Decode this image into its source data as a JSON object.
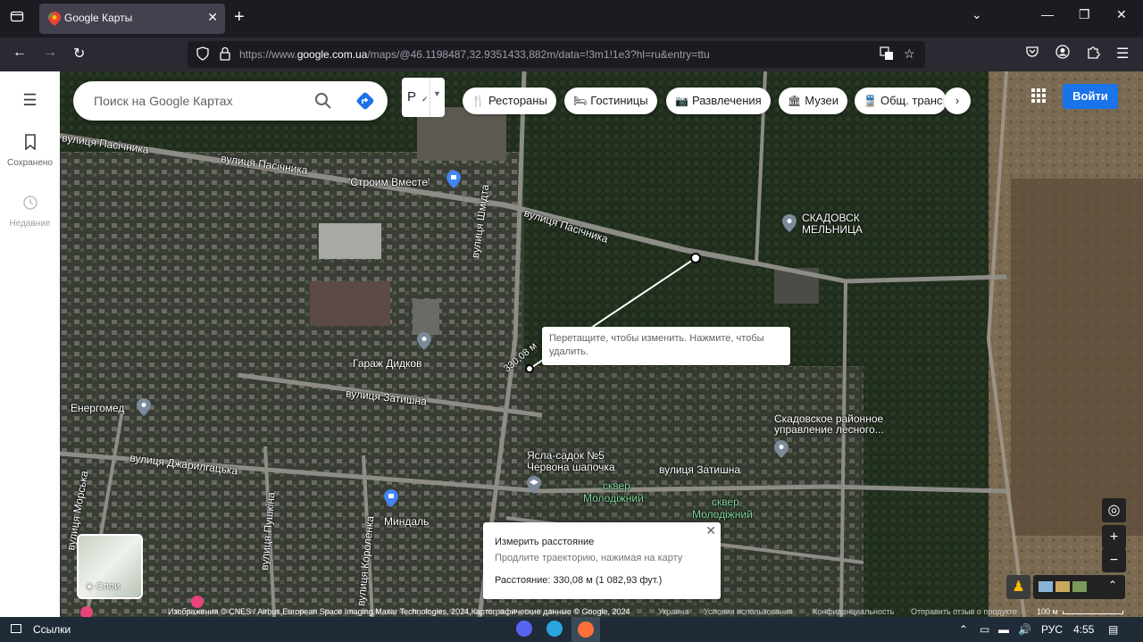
{
  "browser": {
    "tab_title": "Google Карты",
    "url_prefix": "https://www.",
    "url_domain": "google.com.ua",
    "url_rest": "/maps/@46.1198487,32.9351433,882m/data=!3m1!1e3?hl=ru&entry=ttu"
  },
  "sidebar": {
    "menu_icon": "menu-icon",
    "saved_label": "Сохранено",
    "recent_label": "Недавние"
  },
  "search": {
    "placeholder": "Поиск на Google Картах"
  },
  "language_button": "Р",
  "chips": [
    {
      "label": "Рестораны",
      "icon": "restaurant-icon"
    },
    {
      "label": "Гостиницы",
      "icon": "hotel-icon"
    },
    {
      "label": "Развлечения",
      "icon": "camera-icon"
    },
    {
      "label": "Музеи",
      "icon": "museum-icon"
    },
    {
      "label": "Общ. транс",
      "icon": "transit-icon"
    }
  ],
  "login_label": "Войти",
  "map_labels": {
    "street_1": "вулиця Пасічника",
    "street_2": "вулиця Пасічника",
    "street_3": "вулиця Пасічника",
    "stroim": "'Строим Вместе'",
    "skadovsk_mill_1": "СКАДОВСК",
    "skadovsk_mill_2": "МЕЛЬНИЦА",
    "schmidt": "вулиця Шмідта",
    "garage": "Гараж Дидков",
    "zatyshna_1": "вулиця Затишна",
    "zatyshna_2": "вулиця Затишна",
    "energomed": "Енергомед",
    "forestry_1": "Скадовское районное",
    "forestry_2": "управление лесного...",
    "dzharylgatska": "вулиця Джарилгацька",
    "kindergarten_1": "Ясла-садок №5",
    "kindergarten_2": "Червона шапочка",
    "park_1a": "сквер",
    "park_1b": "Молодіжний",
    "park_2a": "сквер",
    "park_2b": "Молодіжний",
    "morska": "вулиця Морська",
    "pushkina": "вулиця Пушкіна",
    "korolenka": "вулиця Короленка",
    "mindal": "Миндаль",
    "measure_line_label": "330,08 м"
  },
  "tooltip": "Перетащите, чтобы изменить. Нажмите, чтобы удалить.",
  "measure": {
    "title": "Измерить расстояние",
    "subtitle": "Продлите траекторию, нажимая на карту",
    "distance": "Расстояние: 330,08 м (1 082,93 фут.)"
  },
  "layers_label": "Слои",
  "attribution": {
    "imagery": "Изображения © CNES / Airbus,European Space Imaging,Maxar Technologies, 2024,Картографические данные © Google, 2024",
    "country": "Украина",
    "terms": "Условия использования",
    "privacy": "Конфиденциальность",
    "feedback": "Отправить отзыв о продукте",
    "scale": "100 м"
  },
  "taskbar": {
    "links": "Ссылки",
    "lang": "РУС",
    "time": "4:55"
  },
  "colors": {
    "accent": "#1a73e8",
    "browser_bg": "#1c1b22",
    "taskbar_bg": "#1f2b36"
  }
}
